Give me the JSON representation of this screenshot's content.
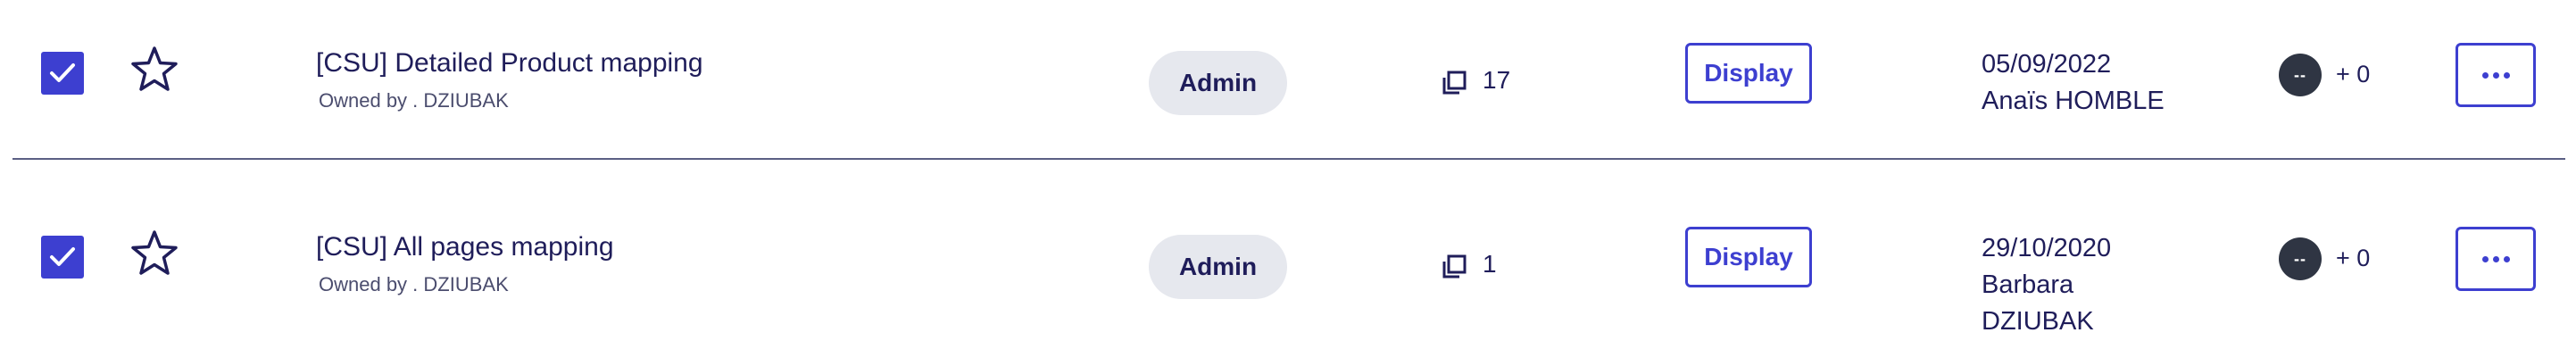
{
  "rows": [
    {
      "checked": true,
      "title": "[CSU] Detailed Product mapping",
      "owner": "Owned by . DZIUBAK",
      "role": "Admin",
      "pages_count": "17",
      "display_label": "Display",
      "date": "05/09/2022",
      "author_line1": "Anaïs HOMBLE",
      "author_line2": "",
      "avatar_initials": "--",
      "extra_users": "+ 0"
    },
    {
      "checked": true,
      "title": "[CSU] All pages mapping",
      "owner": "Owned by . DZIUBAK",
      "role": "Admin",
      "pages_count": "1",
      "display_label": "Display",
      "date": "29/10/2020",
      "author_line1": "Barbara",
      "author_line2": "DZIUBAK",
      "avatar_initials": "--",
      "extra_users": "+ 0"
    }
  ],
  "icons": {
    "checkbox": "checkmark-icon",
    "favorite": "star-outline-icon",
    "pages": "pages-stack-icon",
    "more": "more-horizontal-icon"
  },
  "colors": {
    "accent": "#3d3fd0",
    "text": "#1f1d5a",
    "badge_bg": "#e6e8ee",
    "avatar_bg": "#2f3543",
    "divider": "#5b5f84"
  }
}
